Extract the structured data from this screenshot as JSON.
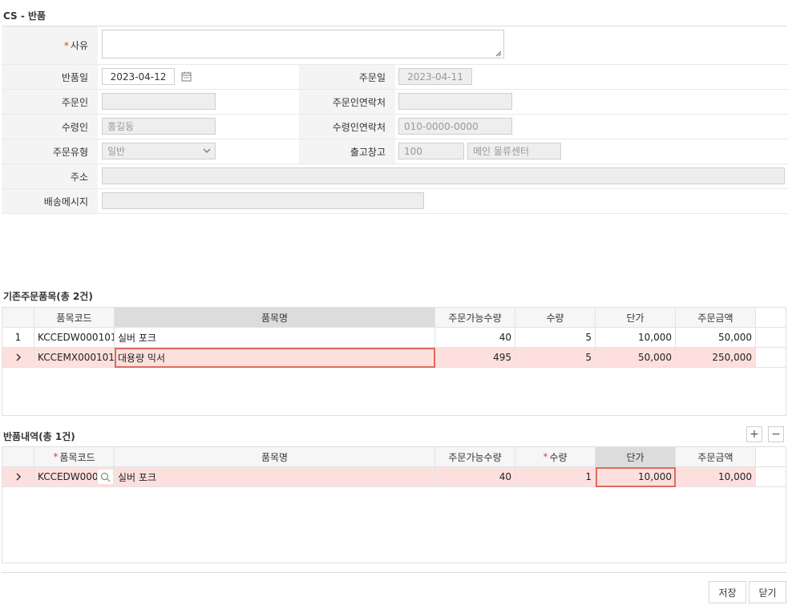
{
  "page": {
    "title": "CS - 반품"
  },
  "form": {
    "reason": {
      "label": "사유",
      "value": ""
    },
    "return_date": {
      "label": "반품일",
      "value": "2023-04-12"
    },
    "order_date": {
      "label": "주문일",
      "value": "2023-04-11"
    },
    "orderer": {
      "label": "주문인",
      "value": ""
    },
    "orderer_contact": {
      "label": "주문인연락처",
      "value": ""
    },
    "receiver": {
      "label": "수령인",
      "value": "홍길동"
    },
    "receiver_contact": {
      "label": "수령인연락처",
      "value": "010-0000-0000"
    },
    "order_type": {
      "label": "주문유형",
      "value": "일반"
    },
    "warehouse": {
      "label": "출고창고",
      "code": "100",
      "name": "메인 물류센터"
    },
    "address": {
      "label": "주소",
      "value": ""
    },
    "delivery_msg": {
      "label": "배송메시지",
      "value": ""
    }
  },
  "orig_grid": {
    "title": "기존주문품목(총 2건)",
    "headers": [
      "품목코드",
      "품목명",
      "주문가능수량",
      "수량",
      "단가",
      "주문금액"
    ],
    "rows": [
      {
        "marker": "1",
        "code": "KCCEDW000101",
        "name": "실버 포크",
        "avail": "40",
        "qty": "5",
        "price": "10,000",
        "amount": "50,000"
      },
      {
        "marker": "",
        "code": "KCCEMX000101",
        "name": "대용량 믹서",
        "avail": "495",
        "qty": "5",
        "price": "50,000",
        "amount": "250,000"
      }
    ]
  },
  "return_grid": {
    "title": "반품내역(총 1건)",
    "headers": [
      "품목코드",
      "품목명",
      "주문가능수량",
      "수량",
      "단가",
      "주문금액"
    ],
    "rows": [
      {
        "code": "KCCEDW000",
        "name": "실버 포크",
        "avail": "40",
        "qty": "1",
        "price": "10,000",
        "amount": "10,000"
      }
    ],
    "add_label": "+",
    "remove_label": "−"
  },
  "buttons": {
    "save": "저장",
    "close": "닫기"
  },
  "colors": {
    "accent": "#e06a5c",
    "selected_row": "#fde0de",
    "required": "#e0452c"
  }
}
